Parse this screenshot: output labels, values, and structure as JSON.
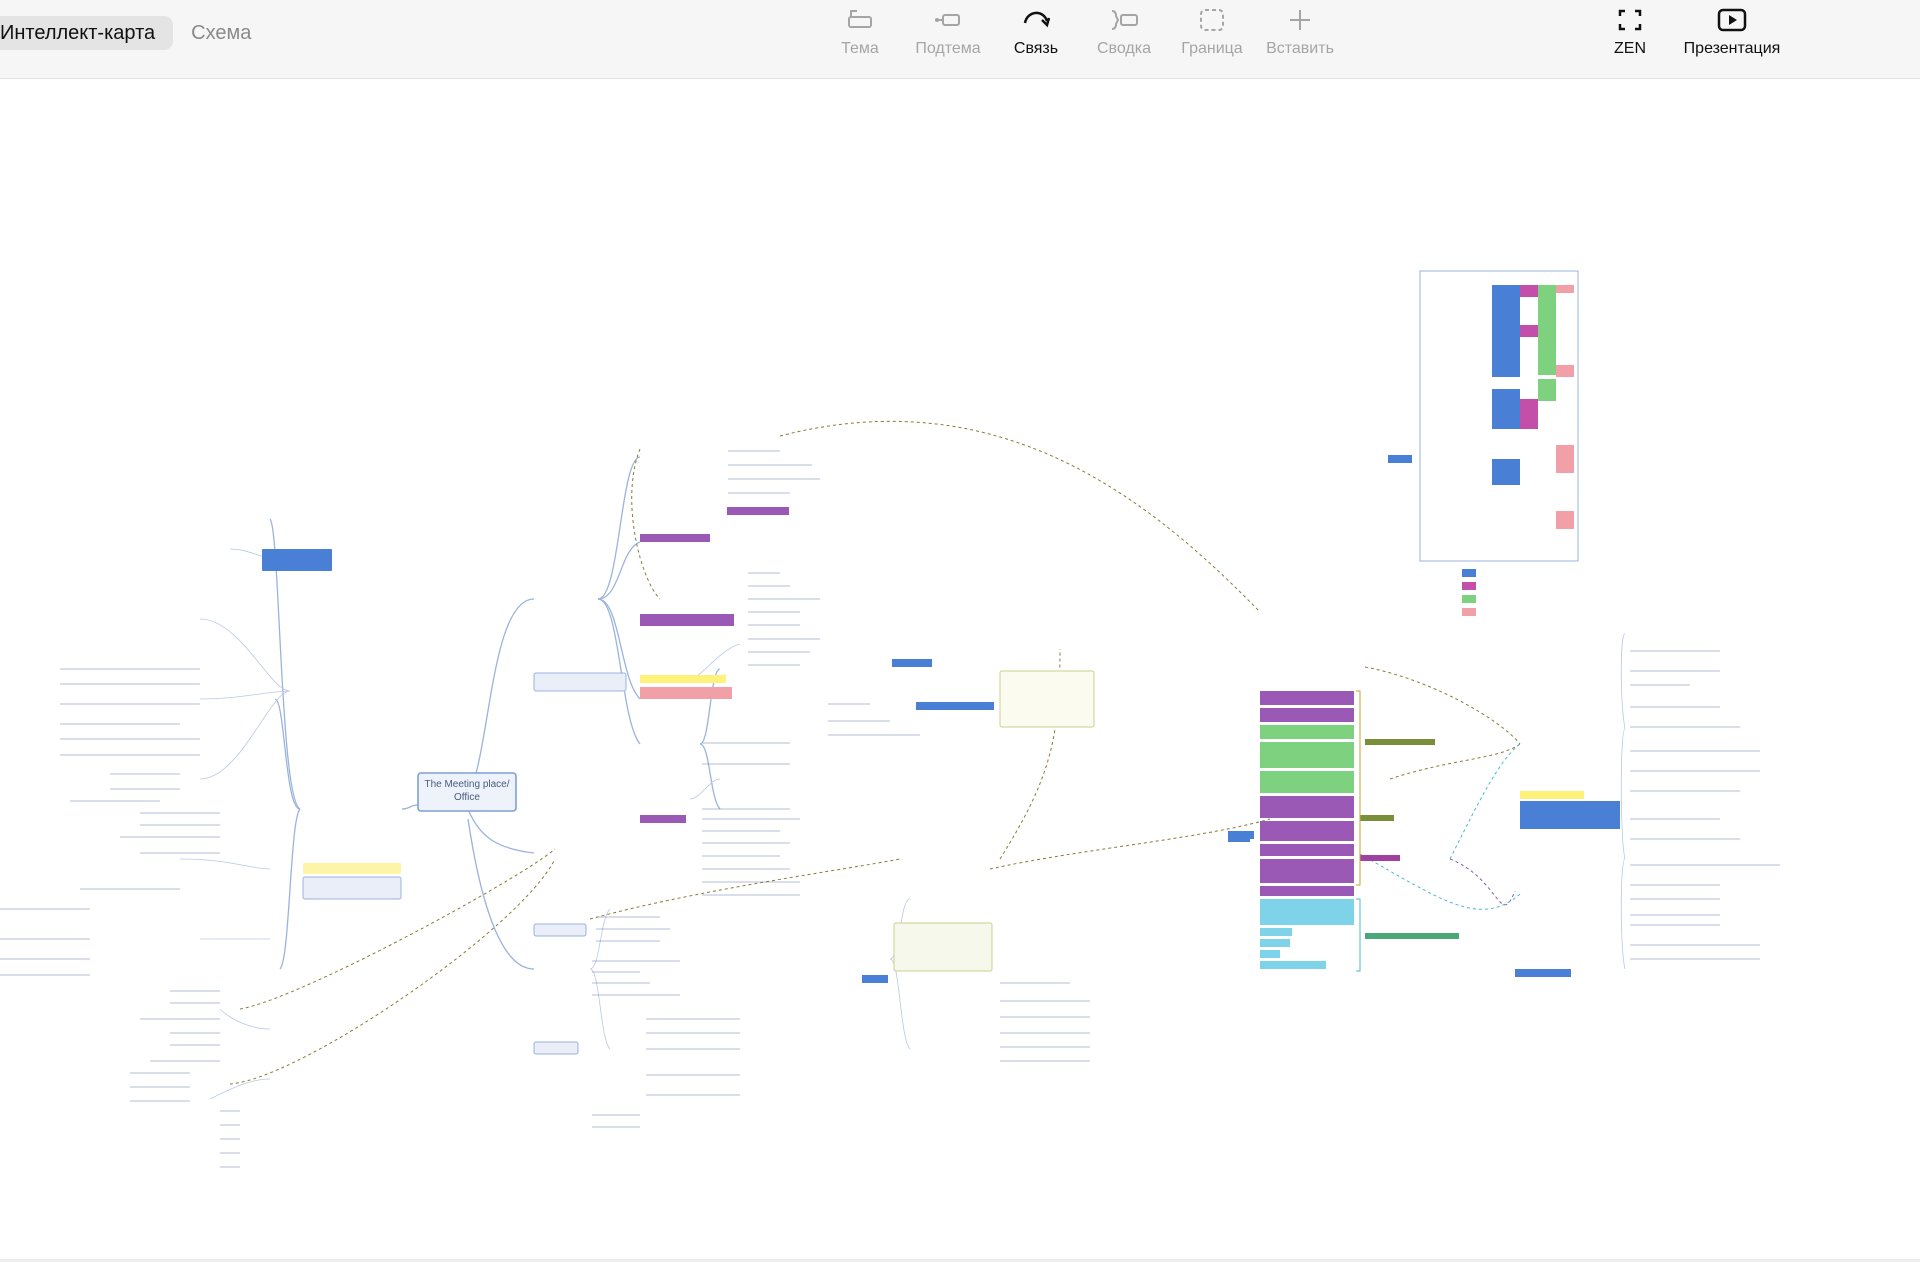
{
  "tabs": [
    {
      "label": "Интеллект-карта",
      "active": true
    },
    {
      "label": "Схема",
      "active": false
    }
  ],
  "tools": [
    {
      "label": "Тема",
      "icon": "topic-icon",
      "enabled": false
    },
    {
      "label": "Подтема",
      "icon": "subtopic-icon",
      "enabled": false
    },
    {
      "label": "Связь",
      "icon": "relationship-icon",
      "enabled": true
    },
    {
      "label": "Сводка",
      "icon": "summary-icon",
      "enabled": false
    },
    {
      "label": "Граница",
      "icon": "boundary-icon",
      "enabled": false
    },
    {
      "label": "Вставить",
      "icon": "insert-plus-icon",
      "enabled": false
    }
  ],
  "right_tools": [
    {
      "label": "ZEN",
      "icon": "zen-fullscreen-icon"
    },
    {
      "label": "Презентация",
      "icon": "presentation-play-icon"
    }
  ],
  "mindmap": {
    "root": "The Meeting place/ Office",
    "colors": {
      "root_border": "#7d9fd6",
      "branch_line": "#9bb3dc",
      "relation_line": "#8a7a33",
      "purple": "#9b59b6",
      "magenta": "#c34fa8",
      "pink": "#f2a0a8",
      "green": "#7ed17e",
      "blue": "#4a7fd6",
      "yellow": "#fff27a",
      "cyan": "#7fd3e8",
      "olive": "#7a8f3a"
    }
  }
}
